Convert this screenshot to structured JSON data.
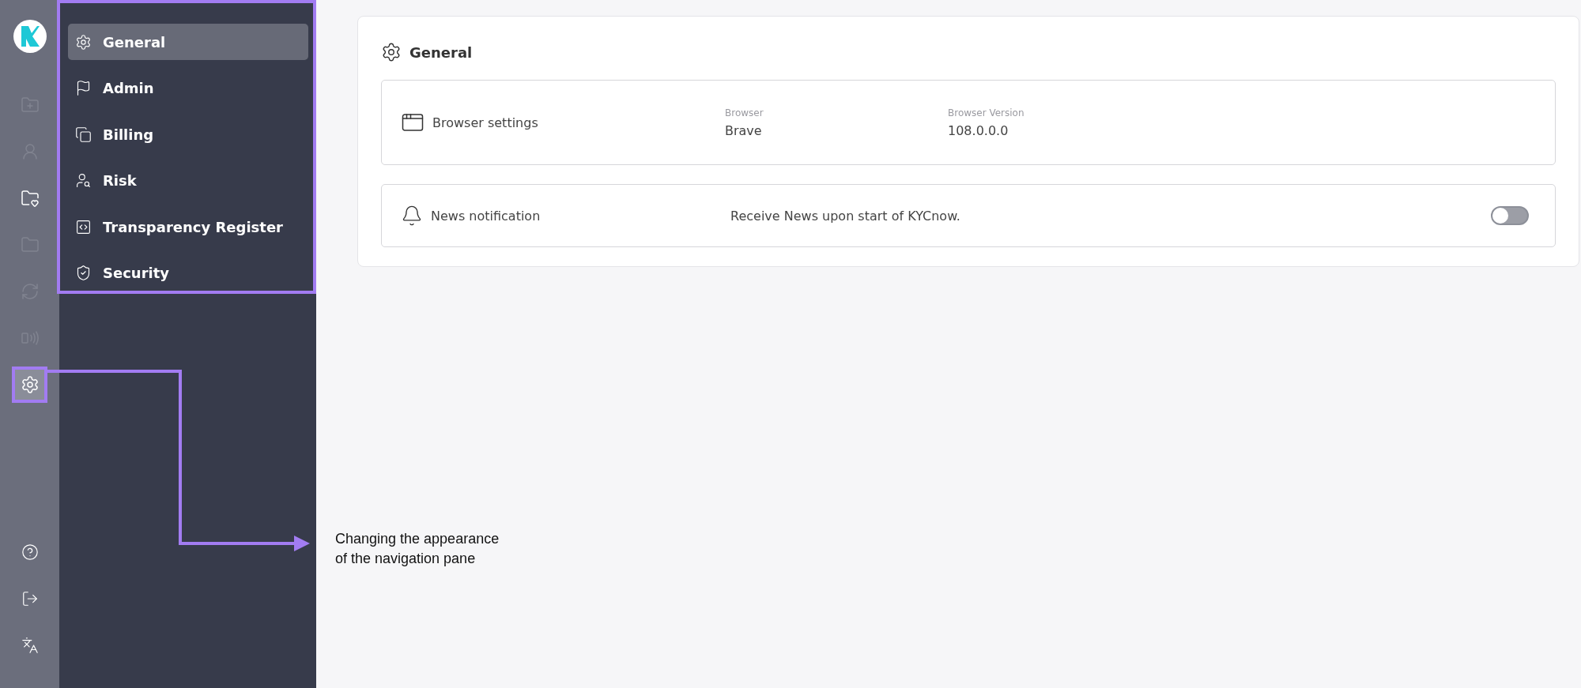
{
  "rail": {
    "items": [
      {
        "kind": "folder-add",
        "selected": false,
        "disabled": true
      },
      {
        "kind": "person",
        "selected": false,
        "disabled": true
      },
      {
        "kind": "folder-star",
        "selected": false,
        "disabled": false
      },
      {
        "kind": "folder",
        "selected": false,
        "disabled": true
      },
      {
        "kind": "sync",
        "selected": false,
        "disabled": true
      },
      {
        "kind": "phone-sync",
        "selected": false,
        "disabled": true
      },
      {
        "kind": "settings",
        "selected": true,
        "disabled": false
      }
    ],
    "bottom_items": [
      {
        "kind": "help"
      },
      {
        "kind": "logout"
      },
      {
        "kind": "translate"
      }
    ]
  },
  "sidebar": {
    "items": [
      {
        "label": "General",
        "kind": "settings",
        "selected": true
      },
      {
        "label": "Admin",
        "kind": "flag",
        "selected": false
      },
      {
        "label": "Billing",
        "kind": "copy",
        "selected": false
      },
      {
        "label": "Risk",
        "kind": "user-search",
        "selected": false
      },
      {
        "label": "Transparency Register",
        "kind": "code-window",
        "selected": false
      },
      {
        "label": "Security",
        "kind": "shield",
        "selected": false
      }
    ]
  },
  "panel": {
    "title": "General",
    "browser": {
      "title": "Browser settings",
      "fields": [
        {
          "label": "Browser",
          "value": "Brave"
        },
        {
          "label": "Browser Version",
          "value": "108.0.0.0"
        }
      ]
    },
    "news": {
      "title": "News notification",
      "description": "Receive News upon start of KYCnow.",
      "on": false
    }
  },
  "annotation": {
    "text": "Changing the appearance of the navigation pane"
  }
}
